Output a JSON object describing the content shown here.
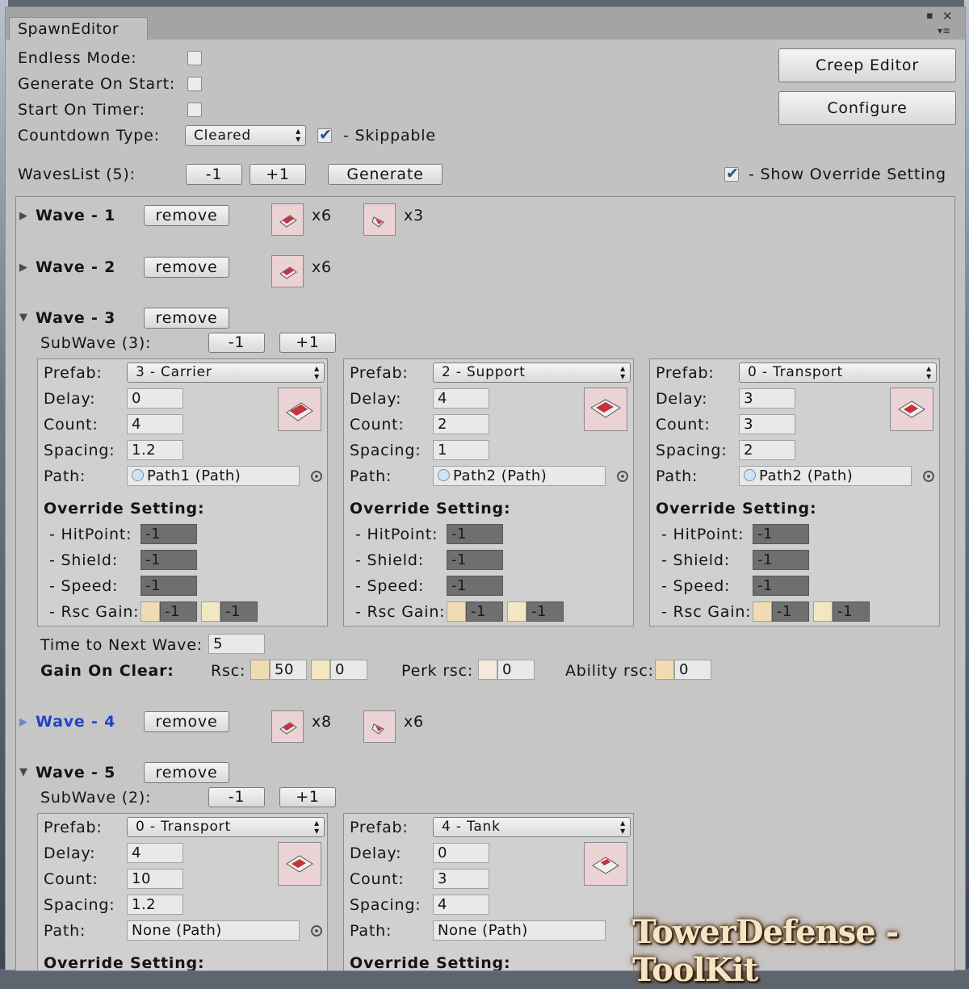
{
  "window": {
    "tab_title": "SpawnEditor",
    "maximize_glyph": "▪",
    "close_glyph": "✕",
    "menu_glyph": "▾≡"
  },
  "settings": {
    "endless_label": "Endless Mode:",
    "endless_checked": false,
    "gen_start_label": "Generate On Start:",
    "gen_start_checked": false,
    "timer_label": "Start On Timer:",
    "timer_checked": false,
    "countdown_label": "Countdown Type:",
    "countdown_value": "Cleared",
    "skippable_label": "- Skippable",
    "skippable_checked": true
  },
  "buttons": {
    "creep_editor": "Creep Editor",
    "configure": "Configure"
  },
  "waveslist": {
    "label": "WavesList (5):",
    "minus": "-1",
    "plus": "+1",
    "generate": "Generate",
    "override_label": "- Show Override Setting",
    "override_checked": true
  },
  "labels": {
    "remove": "remove",
    "prefab": "Prefab:",
    "delay": "Delay:",
    "count": "Count:",
    "spacing": "Spacing:",
    "path": "Path:",
    "override": "Override Setting:",
    "hitpoint": "- HitPoint:",
    "shield": "- Shield:",
    "speed": "- Speed:",
    "rsc_gain": "- Rsc Gain:",
    "time_next": "Time to Next Wave:",
    "gain_clear": "Gain On Clear:",
    "rsc": "Rsc:",
    "perk_rsc": "Perk rsc:",
    "ability_rsc": "Ability rsc:"
  },
  "waves": [
    {
      "title": "Wave - 1",
      "highlight": false,
      "units": [
        "x6",
        "x3"
      ]
    },
    {
      "title": "Wave - 2",
      "highlight": false,
      "units": [
        "x6"
      ]
    },
    {
      "title": "Wave - 3",
      "highlight": false,
      "subwave_label": "SubWave (3):",
      "sub_minus": "-1",
      "sub_plus": "+1",
      "subs": [
        {
          "prefab": "3 - Carrier",
          "delay": "0",
          "count": "4",
          "spacing": "1.2",
          "path": "Path1 (Path)",
          "hitpoint": "-1",
          "shield": "-1",
          "speed": "-1",
          "rsc1": "-1",
          "rsc2": "-1"
        },
        {
          "prefab": "2 - Support",
          "delay": "4",
          "count": "2",
          "spacing": "1",
          "path": "Path2 (Path)",
          "hitpoint": "-1",
          "shield": "-1",
          "speed": "-1",
          "rsc1": "-1",
          "rsc2": "-1"
        },
        {
          "prefab": "0 - Transport",
          "delay": "3",
          "count": "3",
          "spacing": "2",
          "path": "Path2 (Path)",
          "hitpoint": "-1",
          "shield": "-1",
          "speed": "-1",
          "rsc1": "-1",
          "rsc2": "-1"
        }
      ],
      "time_next": "5",
      "gain_rsc1": "50",
      "gain_rsc2": "0",
      "gain_perk": "0",
      "gain_ability": "0"
    },
    {
      "title": "Wave - 4",
      "highlight": true,
      "units": [
        "x8",
        "x6"
      ]
    },
    {
      "title": "Wave - 5",
      "highlight": false,
      "subwave_label": "SubWave (2):",
      "sub_minus": "-1",
      "sub_plus": "+1",
      "subs": [
        {
          "prefab": "0 - Transport",
          "delay": "4",
          "count": "10",
          "spacing": "1.2",
          "path": "None (Path)"
        },
        {
          "prefab": "4 - Tank",
          "delay": "0",
          "count": "3",
          "spacing": "4",
          "path": "None (Path)"
        }
      ]
    }
  ],
  "watermark": "TowerDefense - ToolKit",
  "colors": {
    "highlight": "#1f44c8",
    "override_field": "#6f6f6f",
    "window_bg": "#c2c2c2"
  }
}
